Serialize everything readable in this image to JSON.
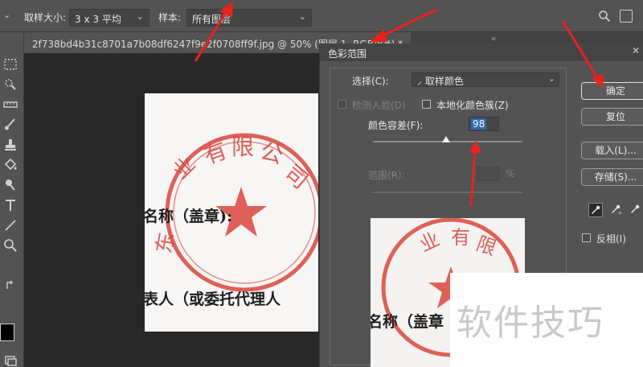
{
  "options_bar": {
    "sample_size_label": "取样大小:",
    "sample_size_value": "3 x 3 平均",
    "sample_label": "样本:",
    "sample_value": "所有图层"
  },
  "document_tab": {
    "title": "2f738bd4b31c8701a7b08df6247f9e2f0708ff9f.jpg @ 50% (图层 1, RGB/8#) *"
  },
  "document": {
    "lines": [
      "名称（盖章):",
      "表人（或委托代理人"
    ]
  },
  "dialog": {
    "title": "色彩范围",
    "select_label": "选择(C):",
    "select_value": "取样颜色",
    "detect_faces_label": "检测人脸(D)",
    "localized_label": "本地化颜色簇(Z)",
    "fuzziness_label": "颜色容差(F):",
    "fuzziness_value": "98",
    "fuzziness_fraction": 0.49,
    "range_label": "范围(R):",
    "range_unit": "%",
    "buttons": {
      "ok": "确定",
      "reset": "复位",
      "load": "载入(L)...",
      "save": "存储(S)..."
    },
    "invert_label": "反相(I)",
    "preview_lines": [
      "名称（盖章"
    ]
  },
  "watermark": {
    "text": "软件技巧"
  },
  "colors": {
    "stamp_red": "#d9453c",
    "annotation_red": "#e8231d",
    "selection_blue": "#2d68b2"
  }
}
